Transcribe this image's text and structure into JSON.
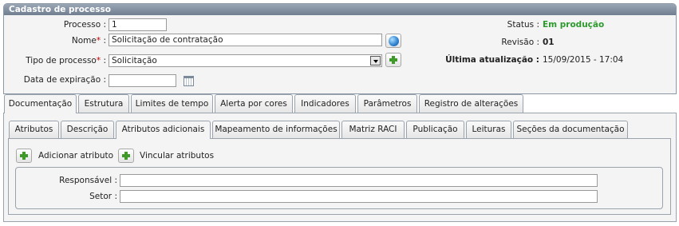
{
  "panel": {
    "title": "Cadastro de processo"
  },
  "form": {
    "processo_label": "Processo :",
    "processo_value": "1",
    "nome_label": "Nome",
    "nome_value": "Solicitação de contratação",
    "tipo_label": "Tipo de processo",
    "tipo_value": "Solicitação",
    "expiracao_label": "Data de expiração :",
    "expiracao_value": "",
    "required_mark": "*",
    "colon": ":"
  },
  "info": {
    "status_label": "Status :",
    "status_value": "Em produção",
    "revisao_label": "Revisão :",
    "revisao_value": "01",
    "atualizacao_label": "Última atualização :",
    "atualizacao_value": "15/09/2015 - 17:04"
  },
  "main_tabs": [
    "Documentação",
    "Estrutura",
    "Limites de tempo",
    "Alerta por cores",
    "Indicadores",
    "Parâmetros",
    "Registro de alterações"
  ],
  "sub_tabs": [
    "Atributos",
    "Descrição",
    "Atributos adicionais",
    "Mapeamento de informações",
    "Matriz RACI",
    "Publicação",
    "Leituras",
    "Seções da documentação"
  ],
  "actions": {
    "add_label": "Adicionar atributo",
    "link_label": "Vincular atributos"
  },
  "attributes": {
    "responsavel_label": "Responsável :",
    "responsavel_value": "",
    "setor_label": "Setor :",
    "setor_value": ""
  },
  "colors": {
    "status_green": "#2d9a2d",
    "header_blue": "#7d8b9c",
    "required_red": "#c00000"
  }
}
